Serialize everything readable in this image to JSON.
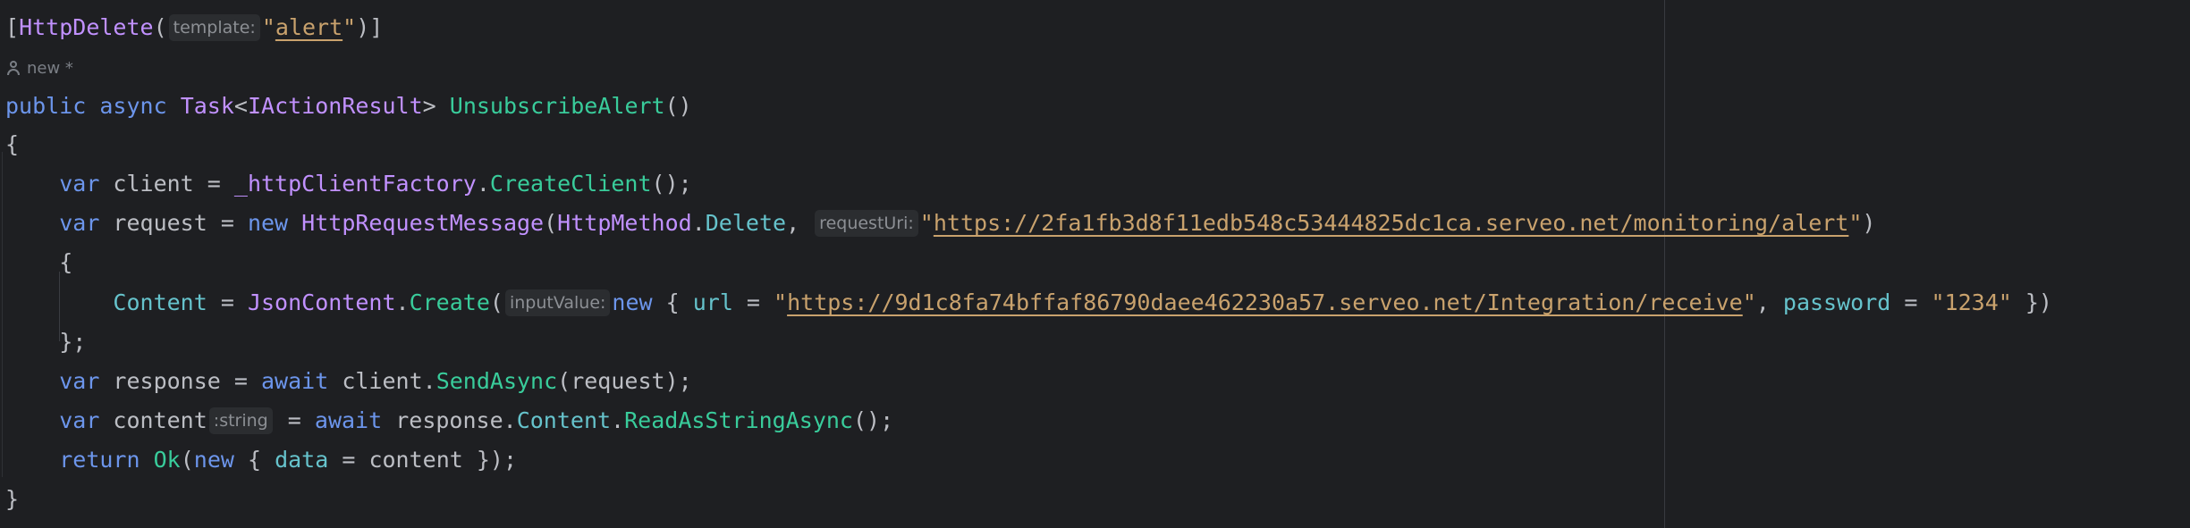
{
  "attribute_line": {
    "open": "[",
    "name": "HttpDelete",
    "paren_open": "(",
    "hint": "template:",
    "quote_open": "\"",
    "value": "alert",
    "quote_close": "\"",
    "close": ")]"
  },
  "author": {
    "icon": "user-icon",
    "text": "new *"
  },
  "signature": {
    "public": "public",
    "async": "async",
    "task": "Task",
    "lt": "<",
    "iaction": "IActionResult",
    "gt": ">",
    "method": "UnsubscribeAlert",
    "parens": "()"
  },
  "brace_open": "{",
  "line_client": {
    "var": "var",
    "name": " client = ",
    "factory": "_httpClientFactory",
    "dot": ".",
    "create": "CreateClient",
    "end": "();"
  },
  "line_request": {
    "var": "var",
    "name": " request = ",
    "new": "new",
    "type": "HttpRequestMessage",
    "paren": "(",
    "httpmethod": "HttpMethod",
    "dot": ".",
    "delete": "Delete",
    "comma": ", ",
    "hint": "requestUri:",
    "q1": "\"",
    "url": "https://2fa1fb3d8f11edb548c53444825dc1ca.serveo.net/monitoring/alert",
    "q2": "\"",
    "close": ")"
  },
  "inner_brace_open": "{",
  "line_content": {
    "content": "Content",
    "eq": " = ",
    "json": "JsonContent",
    "dot": ".",
    "create": "Create",
    "paren": "(",
    "hint": "inputValue:",
    "new": "new",
    "open": " { ",
    "url_prop": "url",
    "eq2": " = ",
    "q1": "\"",
    "url": "https://9d1c8fa74bffaf86790daee462230a57.serveo.net/Integration/receive",
    "q2": "\"",
    "comma": ", ",
    "pwd_prop": "password",
    "eq3": " = ",
    "pwd": "\"1234\"",
    "close": " })"
  },
  "inner_brace_close": "};",
  "line_response": {
    "var": "var",
    "name": " response = ",
    "await": "await",
    "rest": " client.",
    "send": "SendAsync",
    "end": "(request);"
  },
  "line_read": {
    "var": "var",
    "name": " content",
    "hint": ":string",
    "eq": " = ",
    "await": "await",
    "resp": " response.",
    "content": "Content",
    "dot": ".",
    "read": "ReadAsStringAsync",
    "end": "();"
  },
  "line_return": {
    "return": "return",
    "sp": " ",
    "ok": "Ok",
    "paren": "(",
    "new": "new",
    "open": " { ",
    "data": "data",
    "rest": " = content });"
  },
  "brace_close": "}",
  "colors": {
    "background": "#1e1f22",
    "keyword": "#6c95eb",
    "type": "#c191ff",
    "method": "#39cc9b",
    "string": "#c9a26d",
    "property": "#66c3cc",
    "text": "#bcbec4"
  }
}
